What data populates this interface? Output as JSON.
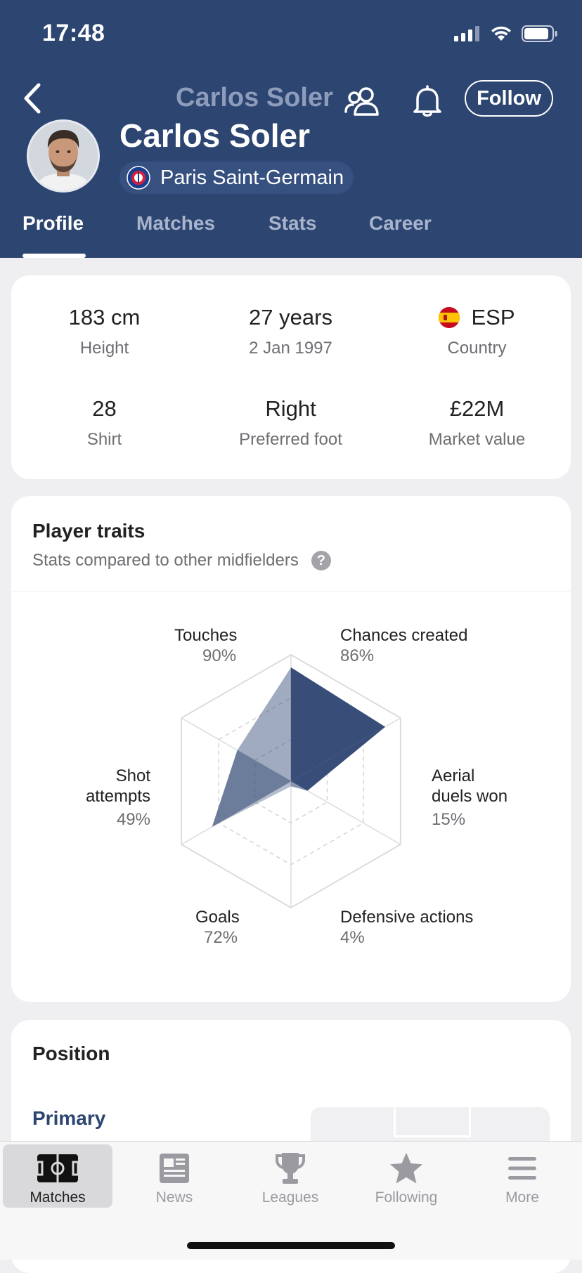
{
  "status_bar": {
    "time": "17:48"
  },
  "header": {
    "ghost_title": "Carlos Soler",
    "follow_label": "Follow",
    "player_name": "Carlos Soler",
    "team_name": "Paris Saint-Germain",
    "colors": {
      "background": "#2d4571",
      "text": "#ffffff"
    }
  },
  "tabs": [
    {
      "label": "Profile",
      "active": true
    },
    {
      "label": "Matches",
      "active": false
    },
    {
      "label": "Stats",
      "active": false
    },
    {
      "label": "Career",
      "active": false
    }
  ],
  "info": [
    {
      "value": "183 cm",
      "label": "Height"
    },
    {
      "value": "27 years",
      "label": "2 Jan 1997"
    },
    {
      "value": "ESP",
      "label": "Country",
      "icon": "spain-flag-icon"
    },
    {
      "value": "28",
      "label": "Shirt"
    },
    {
      "value": "Right",
      "label": "Preferred foot"
    },
    {
      "value": "£22M",
      "label": "Market value"
    }
  ],
  "traits": {
    "title": "Player traits",
    "subtitle": "Stats compared to other midfielders",
    "help_glyph": "?",
    "items": [
      {
        "name": "Touches",
        "percent": "90%",
        "value": 0.9
      },
      {
        "name": "Chances created",
        "percent": "86%",
        "value": 0.86
      },
      {
        "name": "Aerial duels won",
        "name_line1": "Aerial",
        "name_line2": "duels won",
        "percent": "15%",
        "value": 0.15
      },
      {
        "name": "Defensive actions",
        "percent": "4%",
        "value": 0.04
      },
      {
        "name": "Goals",
        "percent": "72%",
        "value": 0.72
      },
      {
        "name": "Shot attempts",
        "name_line1": "Shot",
        "name_line2": "attempts",
        "percent": "49%",
        "value": 0.49
      }
    ],
    "fill_color": "#2d4571"
  },
  "position": {
    "title": "Position",
    "primary_label": "Primary"
  },
  "bottom_nav": [
    {
      "label": "Matches",
      "icon": "pitch-icon",
      "active": true
    },
    {
      "label": "News",
      "icon": "newspaper-icon",
      "active": false
    },
    {
      "label": "Leagues",
      "icon": "trophy-icon",
      "active": false
    },
    {
      "label": "Following",
      "icon": "star-icon",
      "active": false
    },
    {
      "label": "More",
      "icon": "menu-icon",
      "active": false
    }
  ]
}
